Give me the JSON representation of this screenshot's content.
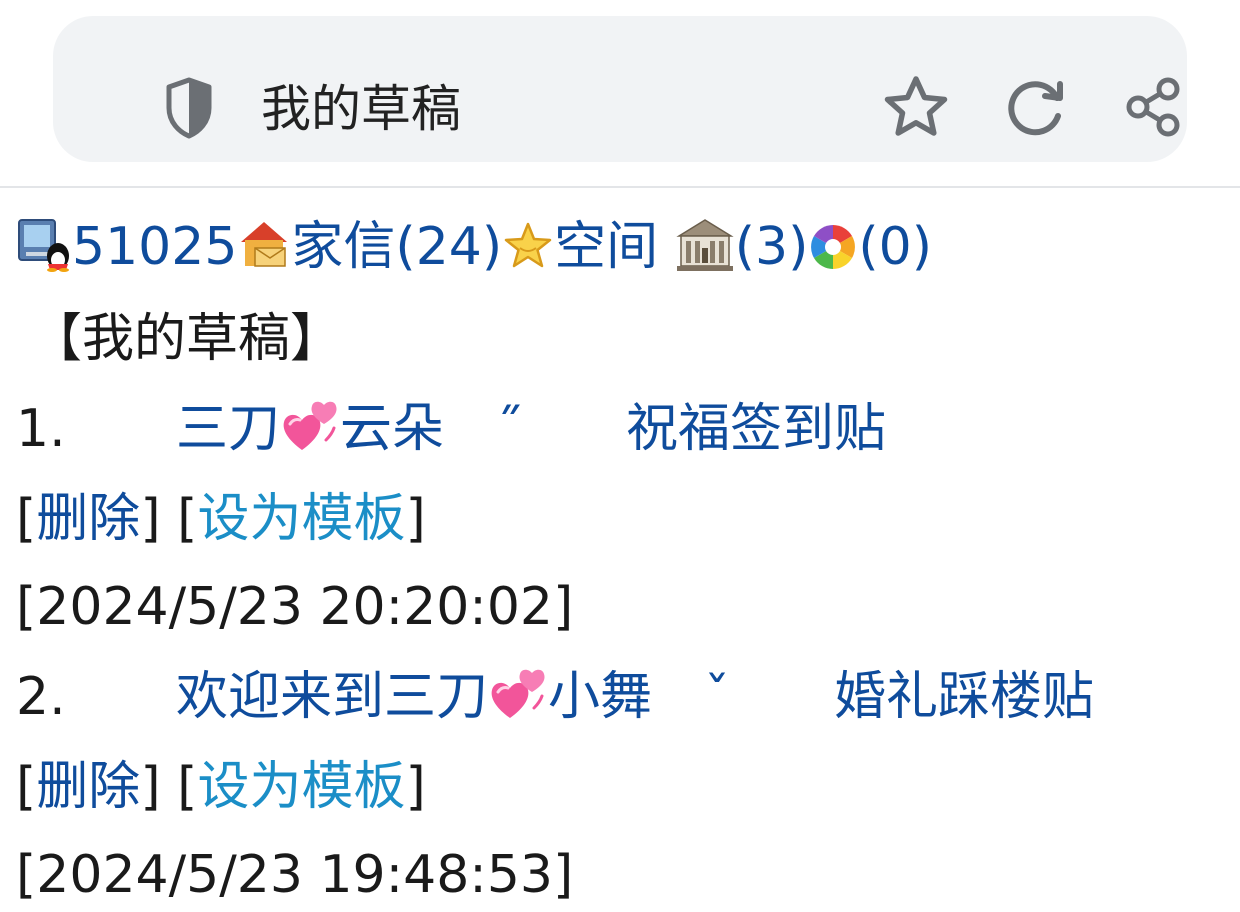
{
  "browser": {
    "address_title": "我的草稿"
  },
  "status": {
    "user_id": "51025",
    "mail_label": "家信(24)",
    "space_label": "空间",
    "hall_count": "(3)",
    "misc_count": "(0)"
  },
  "page": {
    "heading": "【我的草稿】"
  },
  "drafts": [
    {
      "index": "1.",
      "title_part1": "三刀",
      "title_part2": "云朵　˝　　祝福签到贴",
      "delete_label": "删除",
      "template_label": "设为模板",
      "timestamp": "[2024/5/23 20:20:02]"
    },
    {
      "index": "2.",
      "title_part1": "欢迎来到三刀",
      "title_part2": "小舞　ˇ　　婚礼踩楼贴",
      "delete_label": "删除",
      "template_label": "设为模板",
      "timestamp": "[2024/5/23 19:48:53]"
    }
  ],
  "colors": {
    "link": "#0f4c9c",
    "link_light": "#1b8ec7",
    "addressbar_bg": "#f1f3f5"
  }
}
